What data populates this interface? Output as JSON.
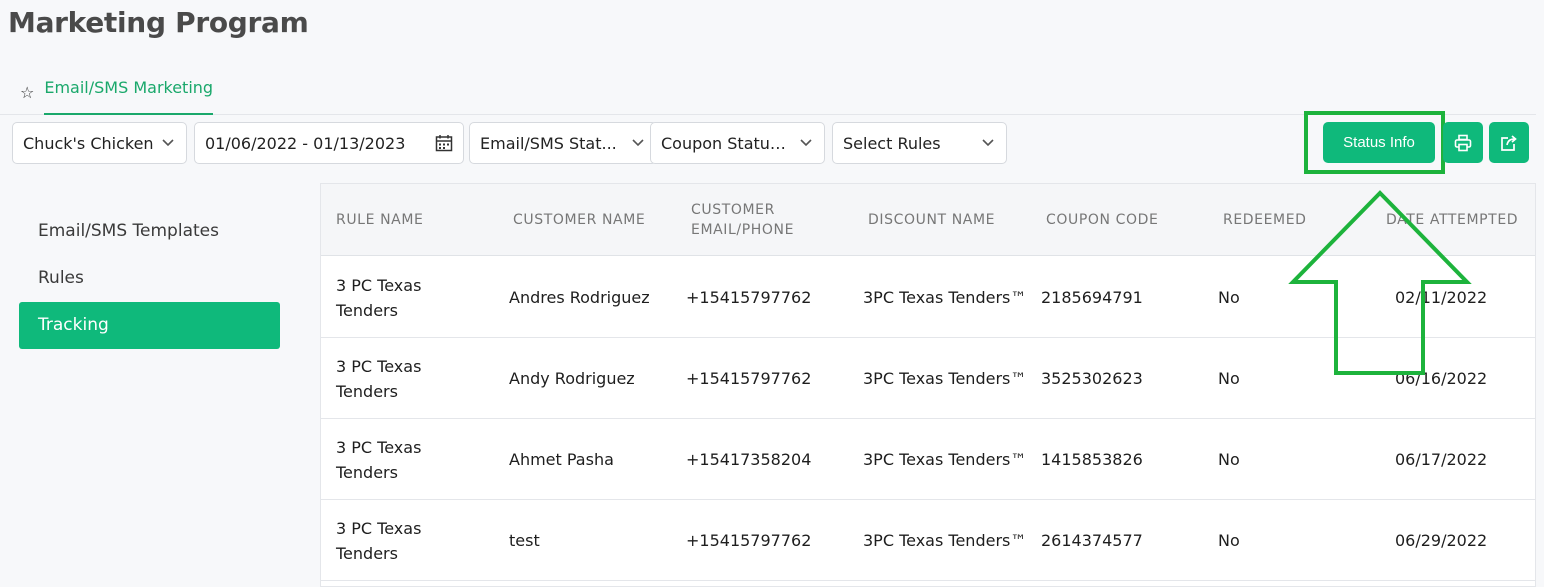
{
  "page": {
    "title": "Marketing Program"
  },
  "tab": {
    "label": "Email/SMS Marketing",
    "icon": "star-icon"
  },
  "filters": {
    "location": "Chuck's Chicken",
    "date_range": "01/06/2022 - 01/13/2023",
    "email_sms_status": "Email/SMS Stat...",
    "coupon_status": "Coupon Status -...",
    "rules": "Select Rules"
  },
  "actions": {
    "status_info_label": "Status Info",
    "print_icon": "printer-icon",
    "export_icon": "share-export-icon"
  },
  "sidebar": {
    "items": [
      {
        "label": "Email/SMS Templates",
        "active": false
      },
      {
        "label": "Rules",
        "active": false
      },
      {
        "label": "Tracking",
        "active": true
      }
    ]
  },
  "table": {
    "columns": [
      "RULE NAME",
      "CUSTOMER NAME",
      "CUSTOMER EMAIL/PHONE",
      "DISCOUNT NAME",
      "COUPON CODE",
      "REDEEMED",
      "DATE ATTEMPTED"
    ],
    "rows": [
      {
        "rule": "3 PC Texas Tenders",
        "customer": "Andres Rodriguez",
        "contact": "+15415797762",
        "discount": "3PC Texas Tenders™",
        "coupon": "2185694791",
        "redeemed": "No",
        "date": "02/11/2022"
      },
      {
        "rule": "3 PC Texas Tenders",
        "customer": "Andy Rodriguez",
        "contact": "+15415797762",
        "discount": "3PC Texas Tenders™",
        "coupon": "3525302623",
        "redeemed": "No",
        "date": "06/16/2022"
      },
      {
        "rule": "3 PC Texas Tenders",
        "customer": "Ahmet Pasha",
        "contact": "+15417358204",
        "discount": "3PC Texas Tenders™",
        "coupon": "1415853826",
        "redeemed": "No",
        "date": "06/17/2022"
      },
      {
        "rule": "3 PC Texas Tenders",
        "customer": "test",
        "contact": "+15415797762",
        "discount": "3PC Texas Tenders™",
        "coupon": "2614374577",
        "redeemed": "No",
        "date": "06/29/2022"
      }
    ]
  },
  "colors": {
    "accent": "#0fb97b",
    "tab_active": "#1aa86b",
    "annotation": "#1db33c"
  }
}
